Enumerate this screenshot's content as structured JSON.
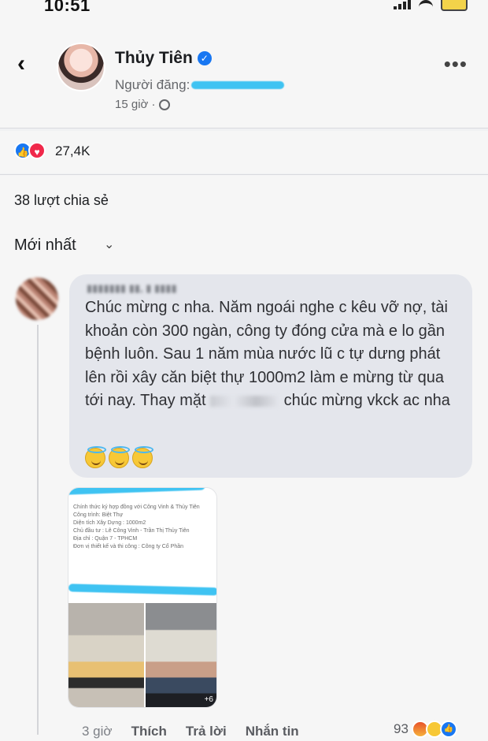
{
  "status_bar": {
    "time": "10:51"
  },
  "post": {
    "poster_name": "Thủy Tiên",
    "posted_by_label": "Người đăng:",
    "time": "15 giờ ·"
  },
  "reactions": {
    "count": "27,4K"
  },
  "shares": {
    "label": "38 lượt chia sẻ"
  },
  "sort": {
    "label": "Mới nhất"
  },
  "comment": {
    "text_before_redaction": "Chúc mừng c nha. Năm ngoái nghe c kêu vỡ nợ, tài khoản còn 300 ngàn, công ty đóng cửa mà e lo gần bệnh luôn. Sau 1 năm mùa nước lũ c tự dưng phát lên rồi xây căn biệt thự 1000m2 làm e mừng từ qua tới nay. Thay mặt",
    "text_after_redaction": "chúc mừng vkck ac nha",
    "shared_card_lines": [
      "Chính thức ký hợp đồng với Công Vinh & Thủy Tiên",
      "Công trình: Biệt Thự",
      "Diện tích Xây Dựng : 1000m2",
      "Chủ đầu tư : Lê Công Vinh - Trần Thị Thủy Tiên",
      "Địa chỉ : Quận 7 - TPHCM",
      "Đơn vị thiết kế và thi công : Công ty Cổ Phần"
    ],
    "actions": {
      "time": "3 giờ",
      "like": "Thích",
      "reply": "Trả lời",
      "message": "Nhắn tin"
    },
    "reaction_count": "93"
  },
  "icons": {
    "back": "back-arrow-icon",
    "verified": "verified-badge-icon",
    "globe": "globe-icon",
    "more": "more-dots-icon",
    "like": "like-icon",
    "love": "love-icon",
    "chevron": "chevron-down-icon",
    "emoji": "smile-halo-icon"
  },
  "colors": {
    "accent": "#1877f2",
    "love": "#f0284a",
    "redaction": "#3fc3f2"
  }
}
